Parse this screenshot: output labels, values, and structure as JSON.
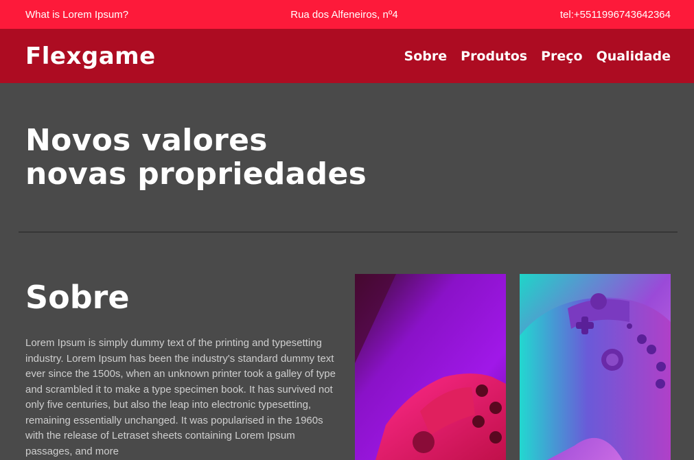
{
  "topbar": {
    "about_link": "What is Lorem Ipsum?",
    "address": "Rua dos Alfeneiros, nº4",
    "phone": "tel:+5511996743642364"
  },
  "navbar": {
    "logo": "Flexgame",
    "links": [
      "Sobre",
      "Produtos",
      "Preço",
      "Qualidade"
    ]
  },
  "hero": {
    "title_line1": "Novos valores",
    "title_line2": "novas propriedades"
  },
  "sobre": {
    "title": "Sobre",
    "text": "Lorem Ipsum is simply dummy text of the printing and typesetting industry. Lorem Ipsum has been the industry's standard dummy text ever since the 1500s, when an unknown printer took a galley of type and scrambled it to make a type specimen book. It has survived not only five centuries, but also the leap into electronic typesetting, remaining essentially unchanged. It was popularised in the 1960s with the release of Letraset sheets containing Lorem Ipsum passages, and more"
  },
  "colors": {
    "topbar_bg": "#fd1a3a",
    "navbar_bg": "#ad0c22",
    "page_bg": "#4a4a4a"
  }
}
